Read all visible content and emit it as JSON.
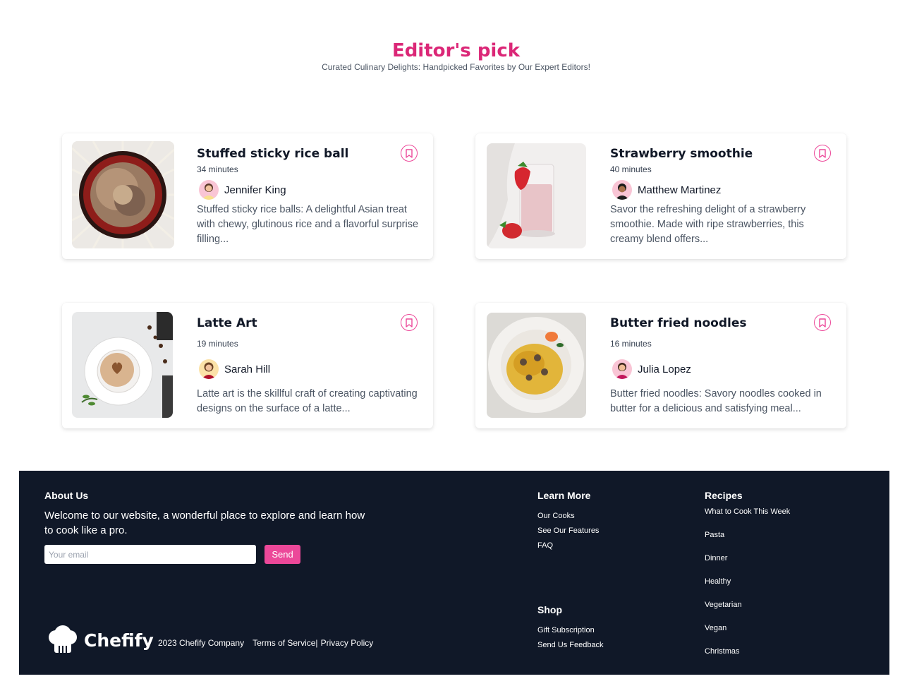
{
  "section": {
    "title": "Editor's pick",
    "subtitle": "Curated Culinary Delights: Handpicked Favorites by Our Expert Editors!"
  },
  "recipes": [
    {
      "title": "Stuffed sticky rice ball",
      "minutes": "34 minutes",
      "author": "Jennifer King",
      "description": "Stuffed sticky rice balls: A delightful Asian treat with chewy, glutinous rice and a flavorful surprise filling...",
      "image": "noodle-bowl-with-chopsticks"
    },
    {
      "title": "Strawberry smoothie",
      "minutes": "40 minutes",
      "author": "Matthew Martinez",
      "description": "Savor the refreshing delight of a strawberry smoothie. Made with ripe strawberries, this creamy blend offers...",
      "image": "strawberry-smoothie-glass"
    },
    {
      "title": "Latte Art",
      "minutes": "19 minutes",
      "author": "Sarah Hill",
      "description": "Latte art is the skillful craft of creating captivating designs on the surface of a latte...",
      "image": "latte-cup-heart"
    },
    {
      "title": "Butter fried noodles",
      "minutes": "16 minutes",
      "author": "Julia Lopez",
      "description": "Butter fried noodles: Savory noodles cooked in butter for a delicious and satisfying meal...",
      "image": "fried-noodle-plate"
    }
  ],
  "footer": {
    "about_heading": "About Us",
    "about_text": "Welcome to our website, a wonderful place to explore and learn how to cook like a pro.",
    "email_placeholder": "Your email",
    "send_label": "Send",
    "learn_more_heading": "Learn More",
    "learn_more_links": [
      "Our Cooks",
      "See Our Features",
      "FAQ"
    ],
    "shop_heading": "Shop",
    "shop_links": [
      "Gift Subscription",
      "Send Us Feedback"
    ],
    "recipes_heading": "Recipes",
    "recipes_links": [
      "What to Cook This Week",
      "Pasta",
      "Dinner",
      "Healthy",
      "Vegetarian",
      "Vegan",
      "Christmas"
    ],
    "brand": "Chefify",
    "copyright": "2023 Chefify Company",
    "terms": "Terms of Service|",
    "privacy": "Privacy Policy"
  },
  "colors": {
    "accent": "#db2777",
    "button": "#ec4899",
    "footer_bg": "#101828"
  }
}
